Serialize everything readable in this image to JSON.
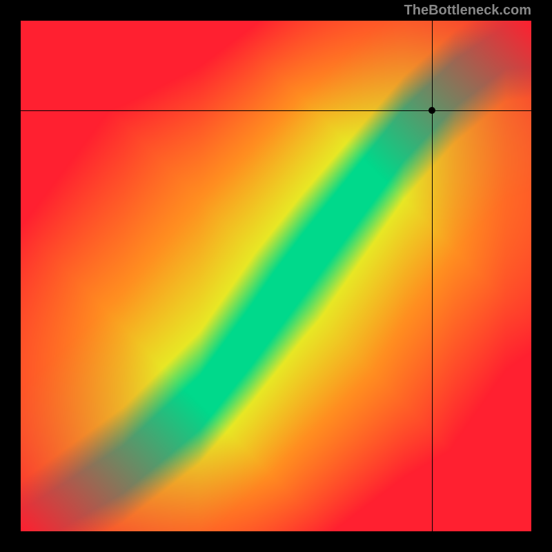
{
  "attribution": "TheBottleneck.com",
  "chart_data": {
    "type": "heatmap",
    "title": "",
    "xlabel": "",
    "ylabel": "",
    "xlim": [
      0,
      100
    ],
    "ylim": [
      0,
      100
    ],
    "grid": false,
    "crosshair": {
      "x_percent": 80.5,
      "y_percent": 17.5
    },
    "optimal_band": {
      "description": "Green optimal zone follows curved diagonal from bottom-left to top-right",
      "curve_points": [
        {
          "x": 0,
          "y": 100
        },
        {
          "x": 20,
          "y": 88
        },
        {
          "x": 35,
          "y": 75
        },
        {
          "x": 45,
          "y": 62
        },
        {
          "x": 55,
          "y": 48
        },
        {
          "x": 65,
          "y": 35
        },
        {
          "x": 75,
          "y": 22
        },
        {
          "x": 85,
          "y": 12
        },
        {
          "x": 95,
          "y": 5
        }
      ],
      "band_width_percent": 8
    },
    "color_scale": {
      "optimal": "#00D98B",
      "near": "#E8E825",
      "warning": "#FF9020",
      "poor": "#FF2030"
    }
  }
}
